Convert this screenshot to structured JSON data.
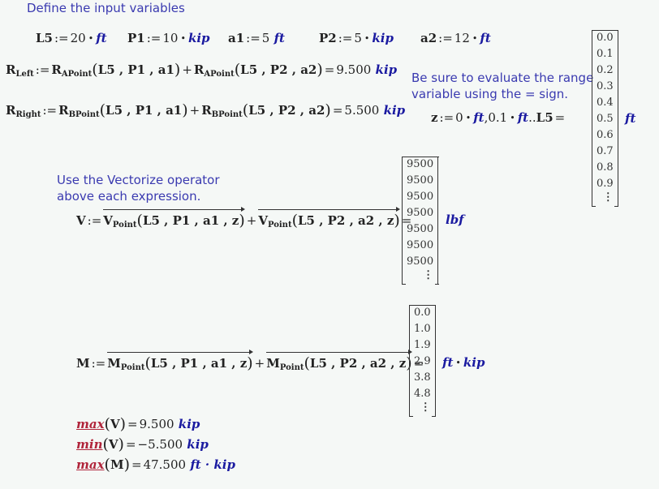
{
  "notes": {
    "define_inputs": "Define the input variables",
    "range_hint_line1": "Be sure to evaluate the range",
    "range_hint_line2": "variable using the = sign.",
    "vectorize_hint_line1": "Use the Vectorize operator",
    "vectorize_hint_line2": "above each expression."
  },
  "inputs": [
    {
      "name": "L5",
      "value": "20",
      "unit": "ft",
      "dot": true
    },
    {
      "name": "P1",
      "value": "10",
      "unit": "kip",
      "dot": true
    },
    {
      "name": "a1",
      "value": "5",
      "unit": "ft",
      "dot": false
    },
    {
      "name": "P2",
      "value": "5",
      "unit": "kip",
      "dot": true
    },
    {
      "name": "a2",
      "value": "12",
      "unit": "ft",
      "dot": true
    }
  ],
  "reactions": {
    "left": {
      "lhs": "R",
      "lhs_sub": "Left",
      "fn": "R",
      "fn_sub": "APoint",
      "args1": "L5 , P1 , a1",
      "args2": "L5 , P2 , a2",
      "result": "9.500",
      "unit": "kip"
    },
    "right": {
      "lhs": "R",
      "lhs_sub": "Right",
      "fn": "R",
      "fn_sub": "BPoint",
      "args1": "L5 , P1 , a1",
      "args2": "L5 , P2 , a2",
      "result": "5.500",
      "unit": "kip"
    }
  },
  "range": {
    "var": "z",
    "start": "0",
    "step": "0.1",
    "start_unit": "ft",
    "end": "L5",
    "values": [
      "0.0",
      "0.1",
      "0.2",
      "0.3",
      "0.4",
      "0.5",
      "0.6",
      "0.7",
      "0.8",
      "0.9"
    ],
    "ellipsis": "⋮",
    "unit": "ft"
  },
  "shear": {
    "lhs": "V",
    "fn": "V",
    "fn_sub": "Point",
    "args1": "L5 , P1 , a1 , z",
    "args2": "L5 , P2 , a2 , z",
    "values": [
      "9500",
      "9500",
      "9500",
      "9500",
      "9500",
      "9500",
      "9500"
    ],
    "ellipsis": "⋮",
    "unit": "lbf"
  },
  "moment": {
    "lhs": "M",
    "fn": "M",
    "fn_sub": "Point",
    "args1": "L5 , P1 , a1 , z",
    "args2": "L5 , P2 , a2 , z",
    "values": [
      "0.0",
      "1.0",
      "1.9",
      "2.9",
      "3.8",
      "4.8"
    ],
    "ellipsis": "⋮",
    "unit_a": "ft",
    "unit_b": "kip"
  },
  "summary": [
    {
      "fn": "max",
      "arg": "V",
      "result": "9.500",
      "unit": "kip"
    },
    {
      "fn": "min",
      "arg": "V",
      "result": "−5.500",
      "unit": "kip"
    },
    {
      "fn": "max",
      "arg": "M",
      "result": "47.500",
      "unit": "ft · kip"
    }
  ],
  "symbols": {
    "assign": ":=",
    "equals": "=",
    "plus": "+",
    "dot": "•",
    "range_sep": "..",
    "comma": ","
  }
}
